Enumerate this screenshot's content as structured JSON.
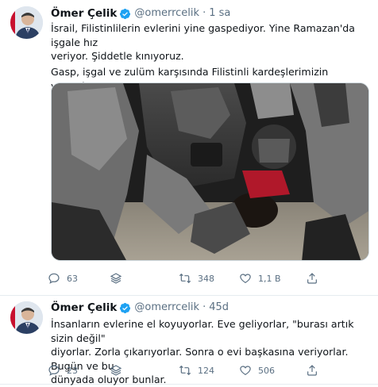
{
  "tweets": [
    {
      "author": {
        "name": "Ömer Çelik",
        "handle": "@omerrcelik",
        "time": "1 sa"
      },
      "text_lines": [
        "İsrail, Filistinlilerin evlerini yine gaspediyor. Yine Ramazan'da işgale hız",
        "veriyor. Şiddetle kınıyoruz."
      ],
      "text2": "Gasp, işgal ve zulüm karşısında Filistinli kardeşlerimizin yanındayız.",
      "actions": {
        "reply_count": "63",
        "retweet_count": "348",
        "like_count": "1,1 B"
      }
    },
    {
      "author": {
        "name": "Ömer Çelik",
        "handle": "@omerrcelik",
        "time": "45d"
      },
      "text_lines": [
        "İnsanların evlerine el koyuyorlar. Eve geliyorlar, \"burası artık sizin değil\"",
        "diyorlar. Zorla çıkarıyorlar. Sonra o evi başkasına veriyorlar. Bugün ve bu",
        "dünyada oluyor bunlar."
      ],
      "actions": {
        "reply_count": "23",
        "retweet_count": "124",
        "like_count": "506"
      }
    }
  ],
  "colors": {
    "verified": "#1da1f2",
    "muted": "#5b7083",
    "text": "#0f1419"
  },
  "icons": [
    "reply-icon",
    "stack-icon",
    "retweet-icon",
    "like-icon",
    "share-icon",
    "verified-icon"
  ]
}
